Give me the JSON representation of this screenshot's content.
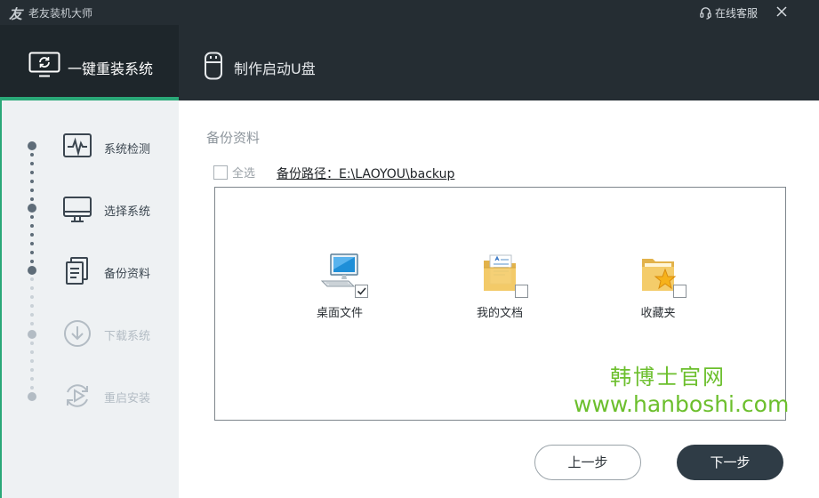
{
  "app": {
    "logo_glyph": "友",
    "title": "老友装机大师",
    "support_label": "在线客服",
    "support_icon": "headset-icon",
    "close_icon": "close-icon"
  },
  "tabs": [
    {
      "label": "一键重装系统",
      "icon": "monitor-refresh-icon",
      "active": true
    },
    {
      "label": "制作启动U盘",
      "icon": "usb-drive-icon",
      "active": false
    }
  ],
  "steps": [
    {
      "label": "系统检测",
      "icon": "pulse-monitor-icon",
      "state": "done"
    },
    {
      "label": "选择系统",
      "icon": "monitor-icon",
      "state": "done"
    },
    {
      "label": "备份资料",
      "icon": "documents-icon",
      "state": "done"
    },
    {
      "label": "下载系统",
      "icon": "download-icon",
      "state": "todo"
    },
    {
      "label": "重启安装",
      "icon": "restart-icon",
      "state": "todo"
    }
  ],
  "backup": {
    "section_title": "备份资料",
    "select_all_label": "全选",
    "select_all_checked": false,
    "path_label": "备份路径：E:\\LAOYOU\\backup",
    "items": [
      {
        "label": "桌面文件",
        "icon": "computer-icon",
        "checked": true
      },
      {
        "label": "我的文档",
        "icon": "documents-folder-icon",
        "checked": false
      },
      {
        "label": "收藏夹",
        "icon": "favorites-folder-icon",
        "checked": false
      }
    ]
  },
  "watermark": {
    "line1": "韩博士官网",
    "line2": "www.hanboshi.com"
  },
  "buttons": {
    "prev": "上一步",
    "next": "下一步"
  },
  "colors": {
    "header_bg": "#252d33",
    "accent_green": "#2aa878",
    "sidebar_bg": "#eef1f3",
    "primary_button": "#2f3c46",
    "watermark": "#6cbf2d"
  }
}
